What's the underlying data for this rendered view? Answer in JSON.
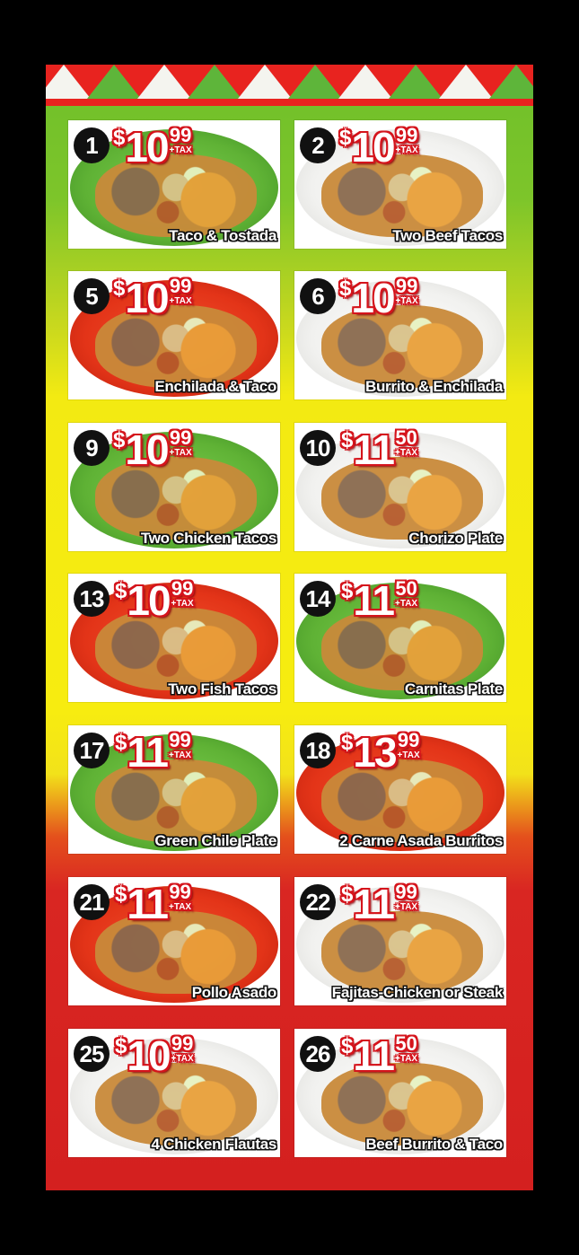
{
  "menu": {
    "tax_label": "+TAX",
    "items": [
      {
        "number": "1",
        "dollars": "10",
        "cents": "99",
        "name": "Taco & Tostada",
        "plate_color": "green"
      },
      {
        "number": "2",
        "dollars": "10",
        "cents": "99",
        "name": "Two Beef Tacos",
        "plate_color": "white"
      },
      {
        "number": "5",
        "dollars": "10",
        "cents": "99",
        "name": "Enchilada & Taco",
        "plate_color": "red"
      },
      {
        "number": "6",
        "dollars": "10",
        "cents": "99",
        "name": "Burrito & Enchilada",
        "plate_color": "white"
      },
      {
        "number": "9",
        "dollars": "10",
        "cents": "99",
        "name": "Two Chicken Tacos",
        "plate_color": "green"
      },
      {
        "number": "10",
        "dollars": "11",
        "cents": "50",
        "name": "Chorizo Plate",
        "plate_color": "white"
      },
      {
        "number": "13",
        "dollars": "10",
        "cents": "99",
        "name": "Two Fish Tacos",
        "plate_color": "red"
      },
      {
        "number": "14",
        "dollars": "11",
        "cents": "50",
        "name": "Carnitas Plate",
        "plate_color": "green"
      },
      {
        "number": "17",
        "dollars": "11",
        "cents": "99",
        "name": "Green Chile Plate",
        "plate_color": "green"
      },
      {
        "number": "18",
        "dollars": "13",
        "cents": "99",
        "name": "2 Carne Asada Burritos",
        "plate_color": "red"
      },
      {
        "number": "21",
        "dollars": "11",
        "cents": "99",
        "name": "Pollo Asado",
        "plate_color": "red"
      },
      {
        "number": "22",
        "dollars": "11",
        "cents": "99",
        "name": "Fajitas-Chicken or Steak",
        "plate_color": "white"
      },
      {
        "number": "25",
        "dollars": "10",
        "cents": "99",
        "name": "4 Chicken Flautas",
        "plate_color": "white"
      },
      {
        "number": "26",
        "dollars": "11",
        "cents": "50",
        "name": "Beef Burrito & Taco",
        "plate_color": "white"
      }
    ]
  },
  "colors": {
    "price_red": "#d5141c",
    "banner_red": "#e8231f",
    "banner_green": "#5eb53a"
  }
}
